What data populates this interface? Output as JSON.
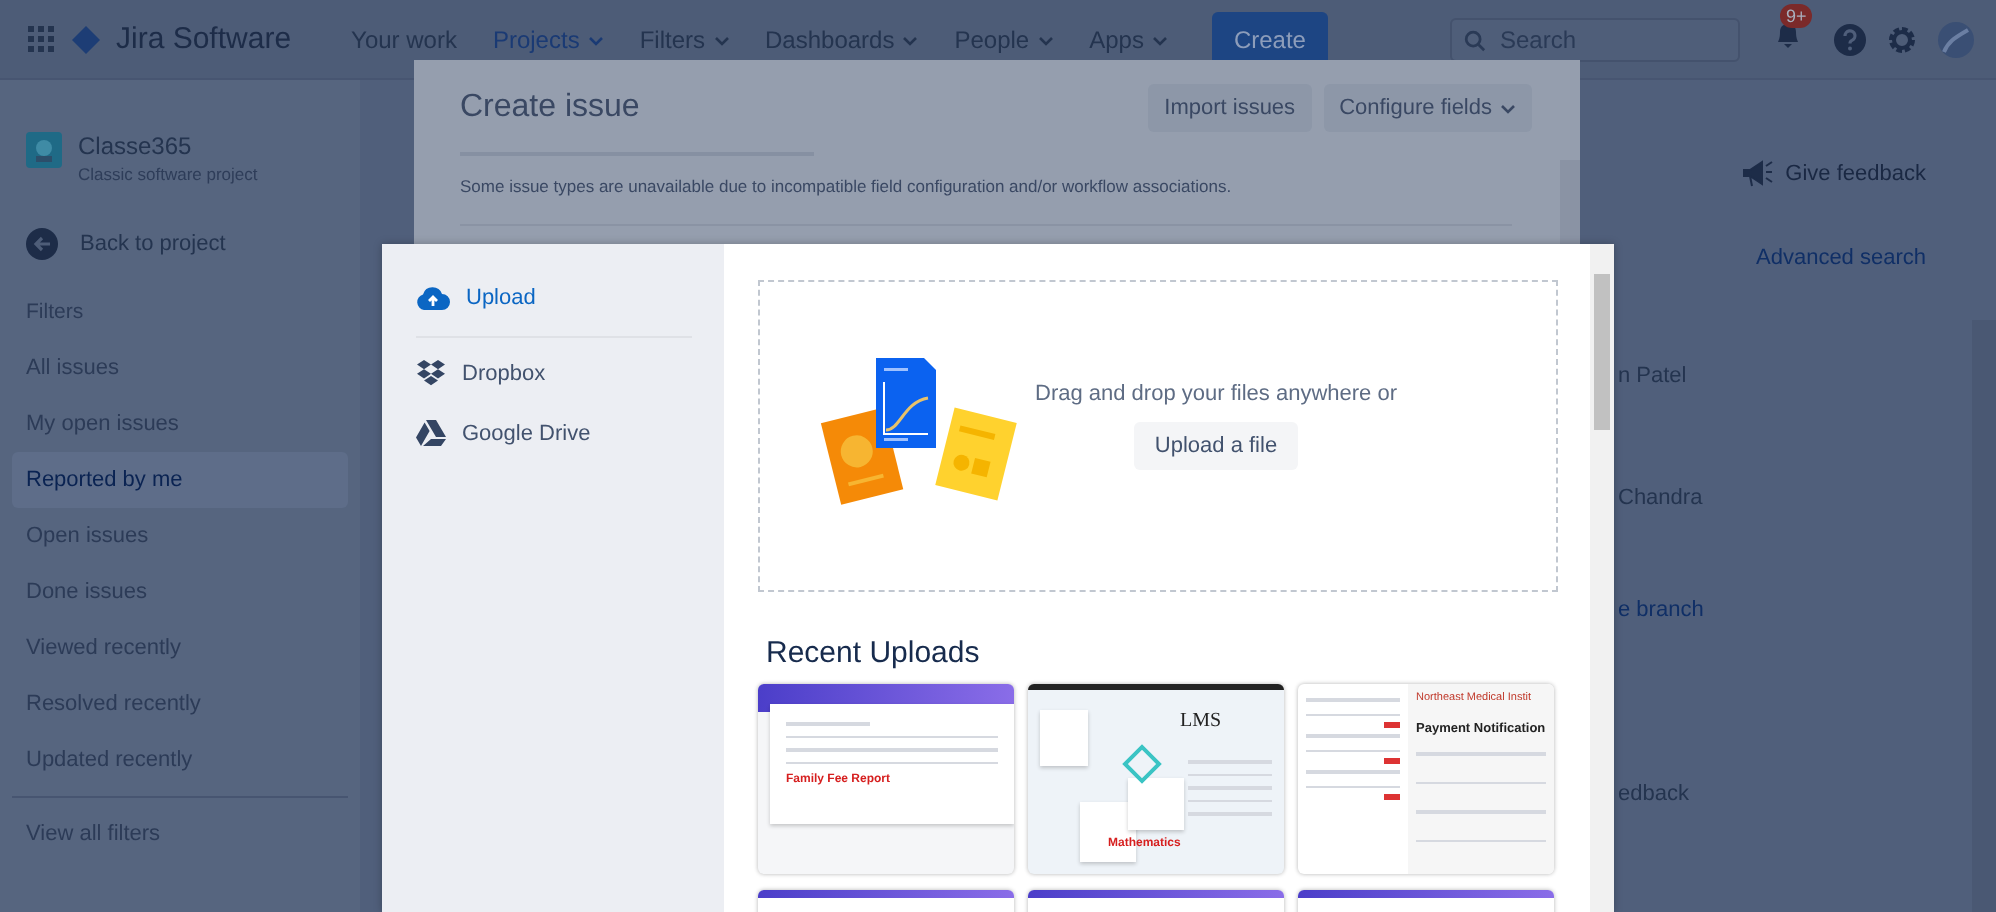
{
  "topbar": {
    "product": "Jira Software",
    "nav": [
      {
        "label": "Your work",
        "selected": false,
        "dropdown": false
      },
      {
        "label": "Projects",
        "selected": true,
        "dropdown": true
      },
      {
        "label": "Filters",
        "selected": false,
        "dropdown": true
      },
      {
        "label": "Dashboards",
        "selected": false,
        "dropdown": true
      },
      {
        "label": "People",
        "selected": false,
        "dropdown": true
      },
      {
        "label": "Apps",
        "selected": false,
        "dropdown": true
      }
    ],
    "create": "Create",
    "search": {
      "placeholder": "Search"
    },
    "notifications_badge": "9+"
  },
  "sidebar": {
    "project": {
      "name": "Classe365",
      "type": "Classic software project"
    },
    "back": "Back to project",
    "heading": "Filters",
    "items": [
      {
        "label": "All issues",
        "selected": false
      },
      {
        "label": "My open issues",
        "selected": false
      },
      {
        "label": "Reported by me",
        "selected": true
      },
      {
        "label": "Open issues",
        "selected": false
      },
      {
        "label": "Done issues",
        "selected": false
      },
      {
        "label": "Viewed recently",
        "selected": false
      },
      {
        "label": "Resolved recently",
        "selected": false
      },
      {
        "label": "Updated recently",
        "selected": false
      }
    ],
    "footer": "View all filters"
  },
  "background_fragments": [
    {
      "text": "Give feedback",
      "kind": "feedback"
    },
    {
      "text": "Advanced search",
      "kind": "link"
    },
    {
      "text": "n Patel",
      "kind": "text"
    },
    {
      "text": "Chandra",
      "kind": "text"
    },
    {
      "text": "e branch",
      "kind": "link"
    },
    {
      "text": "edback",
      "kind": "text"
    }
  ],
  "create_issue": {
    "title": "Create issue",
    "actions": [
      {
        "label": "Import issues",
        "dropdown": false
      },
      {
        "label": "Configure fields",
        "dropdown": true
      }
    ],
    "notice": "Some issue types are unavailable due to incompatible field configuration and/or workflow associations."
  },
  "file_picker": {
    "sources": [
      {
        "label": "Upload",
        "selected": true,
        "kind": "upload"
      },
      {
        "label": "Dropbox",
        "selected": false,
        "kind": "dropbox"
      },
      {
        "label": "Google Drive",
        "selected": false,
        "kind": "drive"
      }
    ],
    "drop_text": "Drag and drop your files anywhere or",
    "upload_button": "Upload a file",
    "recent_heading": "Recent Uploads",
    "recent": [
      {
        "kind": "report",
        "caption": "Family Fee Report"
      },
      {
        "kind": "lms",
        "heading": "LMS",
        "caption": "Mathematics"
      },
      {
        "kind": "payment",
        "brand": "Northeast Medical Instit",
        "heading": "Payment Notification"
      },
      {
        "kind": "cut"
      },
      {
        "kind": "cut"
      },
      {
        "kind": "cut"
      }
    ]
  }
}
